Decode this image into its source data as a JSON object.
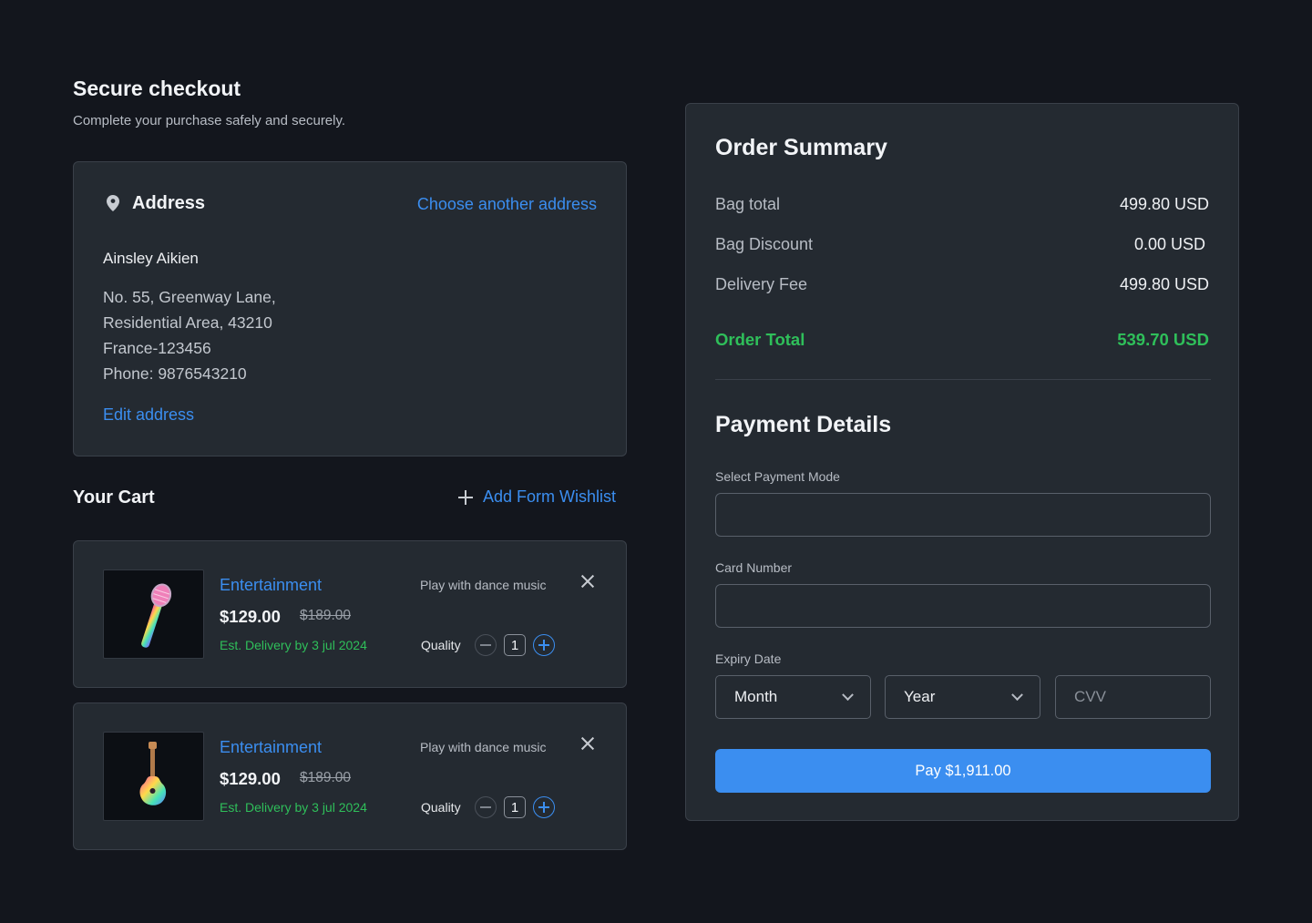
{
  "header": {
    "title": "Secure checkout",
    "subtitle": "Complete your purchase safely and securely."
  },
  "address": {
    "heading": "Address",
    "choose_link": "Choose another address",
    "name": "Ainsley Aikien",
    "lines": [
      "No. 55, Greenway Lane,",
      "Residential Area, 43210",
      "France-123456",
      "Phone: 9876543210"
    ],
    "edit_link": "Edit address"
  },
  "cart": {
    "heading": "Your Cart",
    "add_wishlist": "Add Form Wishlist",
    "items": [
      {
        "category": "Entertainment",
        "price": "$129.00",
        "old_price": "$189.00",
        "delivery": "Est. Delivery by 3 jul 2024",
        "description": "Play with dance music",
        "quality_label": "Quality",
        "quantity": "1",
        "image": "microphone"
      },
      {
        "category": "Entertainment",
        "price": "$129.00",
        "old_price": "$189.00",
        "delivery": "Est. Delivery by 3 jul 2024",
        "description": "Play with dance music",
        "quality_label": "Quality",
        "quantity": "1",
        "image": "guitar"
      }
    ]
  },
  "summary": {
    "title": "Order Summary",
    "rows": [
      {
        "label": "Bag total",
        "value": "499.80 USD"
      },
      {
        "label": "Bag Discount",
        "value": "0.00 USD"
      },
      {
        "label": "Delivery Fee",
        "value": "499.80 USD"
      }
    ],
    "total_label": "Order Total",
    "total_value": "539.70 USD"
  },
  "payment": {
    "title": "Payment Details",
    "mode_label": "Select Payment Mode",
    "card_label": "Card Number",
    "expiry_label": "Expiry Date",
    "month": "Month",
    "year": "Year",
    "cvv_placeholder": "CVV",
    "pay_button": "Pay $1,911.00"
  },
  "colors": {
    "background": "#13161d",
    "card": "#242a31",
    "accent": "#3b8ef0",
    "success": "#2fbf5a"
  }
}
